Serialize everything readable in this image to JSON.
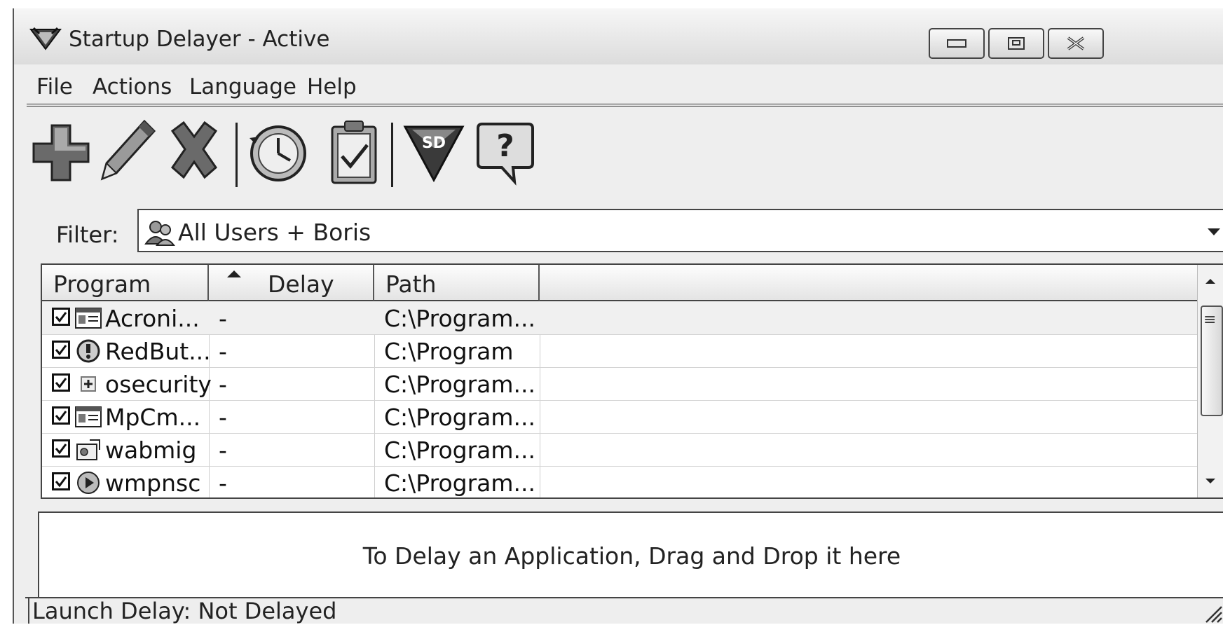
{
  "window": {
    "title": "Startup Delayer - Active",
    "controls": [
      "minimize",
      "restore",
      "close"
    ]
  },
  "menu": [
    "File",
    "Actions",
    "Language",
    "Help"
  ],
  "toolbar": [
    {
      "name": "add",
      "icon": "plus-icon"
    },
    {
      "name": "edit",
      "icon": "pencil-icon"
    },
    {
      "name": "delete",
      "icon": "x-icon"
    },
    {
      "name": "history",
      "icon": "clock-icon"
    },
    {
      "name": "checklist",
      "icon": "clipboard-check-icon"
    },
    {
      "name": "startup-delayer",
      "icon": "sd-logo-icon",
      "label": "SD"
    },
    {
      "name": "help",
      "icon": "question-bubble-icon",
      "label": "?"
    }
  ],
  "filter": {
    "label": "Filter:",
    "value": "All Users + Boris"
  },
  "list": {
    "columns": [
      "Program",
      "Delay",
      "Path"
    ],
    "sorted_column": "Delay",
    "rows": [
      {
        "program": "Acroni...",
        "delay": "-",
        "path": "C:\\Program...",
        "checked": true,
        "icon": "window-icon"
      },
      {
        "program": "RedBut...",
        "delay": "-",
        "path": "C:\\Program",
        "checked": true,
        "icon": "alert-icon"
      },
      {
        "program": "osecurity",
        "delay": "-",
        "path": "C:\\Program...",
        "checked": true,
        "icon": "plus-box-icon"
      },
      {
        "program": "MpCm...",
        "delay": "-",
        "path": "C:\\Program...",
        "checked": true,
        "icon": "window-icon"
      },
      {
        "program": "wabmig",
        "delay": "-",
        "path": "C:\\Program...",
        "checked": true,
        "icon": "contacts-icon"
      },
      {
        "program": "wmpnsc",
        "delay": "-",
        "path": "C:\\Program...",
        "checked": true,
        "icon": "media-icon"
      }
    ]
  },
  "dropzone": {
    "text": "To Delay an Application, Drag and Drop it here"
  },
  "statusbar": {
    "text": "Launch Delay: Not Delayed"
  }
}
